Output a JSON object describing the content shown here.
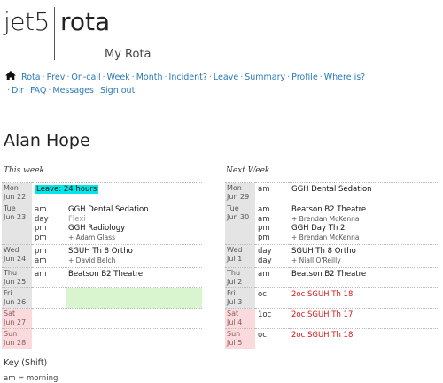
{
  "logo": {
    "left": "jet5",
    "right": "rota"
  },
  "subtitle": "My Rota",
  "nav": {
    "items": [
      {
        "label": "Rota",
        "active": true
      },
      {
        "label": "Prev"
      },
      {
        "label": "On-call"
      },
      {
        "label": "Week"
      },
      {
        "label": "Month"
      },
      {
        "label": "Incident?"
      },
      {
        "label": "Leave"
      },
      {
        "label": "Summary"
      },
      {
        "label": "Profile"
      },
      {
        "label": "Where is?"
      },
      {
        "label": "Dir"
      },
      {
        "label": "FAQ"
      },
      {
        "label": "Messages"
      },
      {
        "label": "Sign out"
      }
    ]
  },
  "person": "Alan Hope",
  "this_week": {
    "title": "This week",
    "rows": [
      {
        "day": "Mon",
        "date": "Jun 22",
        "periods": [],
        "details": [
          {
            "text": "Leave: 24 hours",
            "style": "leave"
          }
        ]
      },
      {
        "day": "Tue",
        "date": "Jun 23",
        "periods": [
          "am",
          "day",
          "pm",
          "pm"
        ],
        "details": [
          {
            "text": "GGH Dental Sedation"
          },
          {
            "text": "Flexi",
            "style": "grey"
          },
          {
            "text": "GGH Radiology"
          },
          {
            "text": "+ Adam Glass",
            "style": "sub"
          }
        ]
      },
      {
        "day": "Wed",
        "date": "Jun 24",
        "periods": [
          "pm",
          "am"
        ],
        "details": [
          {
            "text": "SGUH Th 8 Ortho"
          },
          {
            "text": "+ David Belch",
            "style": "sub"
          }
        ]
      },
      {
        "day": "Thu",
        "date": "Jun 25",
        "periods": [
          "am"
        ],
        "details": [
          {
            "text": "Beatson B2 Theatre"
          }
        ]
      },
      {
        "day": "Fri",
        "date": "Jun 26",
        "periods": [],
        "details": [],
        "green": true
      },
      {
        "day": "Sat",
        "date": "Jun 27",
        "periods": [],
        "details": [],
        "weekend": true
      },
      {
        "day": "Sun",
        "date": "Jun 28",
        "periods": [],
        "details": [],
        "weekend": true
      }
    ]
  },
  "next_week": {
    "title": "Next Week",
    "rows": [
      {
        "day": "Mon",
        "date": "Jun 29",
        "periods": [
          "am"
        ],
        "details": [
          {
            "text": "GGH Dental Sedation"
          }
        ]
      },
      {
        "day": "Tue",
        "date": "Jun 30",
        "periods": [
          "am",
          "am",
          "pm",
          "pm"
        ],
        "details": [
          {
            "text": "Beatson B2 Theatre"
          },
          {
            "text": "+ Brendan McKenna",
            "style": "sub"
          },
          {
            "text": "GGH Day Th 2"
          },
          {
            "text": "+ Brendan McKenna",
            "style": "sub"
          }
        ]
      },
      {
        "day": "Wed",
        "date": "Jul 1",
        "periods": [
          "day",
          "day"
        ],
        "details": [
          {
            "text": "SGUH Th 8 Ortho"
          },
          {
            "text": "+ Niall O'Reilly",
            "style": "sub"
          }
        ]
      },
      {
        "day": "Thu",
        "date": "Jul 2",
        "periods": [
          "am"
        ],
        "details": [
          {
            "text": "Beatson B2 Theatre"
          }
        ]
      },
      {
        "day": "Fri",
        "date": "Jul 3",
        "periods": [
          "oc"
        ],
        "details": [
          {
            "text": "2oc SGUH Th 18",
            "style": "red"
          }
        ]
      },
      {
        "day": "Sat",
        "date": "Jul 4",
        "periods": [
          "1oc"
        ],
        "details": [
          {
            "text": "2oc SGUH Th 17",
            "style": "red"
          }
        ],
        "weekend": true
      },
      {
        "day": "Sun",
        "date": "Jul 5",
        "periods": [
          "oc"
        ],
        "details": [
          {
            "text": "2oc SGUH Th 18",
            "style": "red"
          }
        ],
        "weekend": true
      }
    ]
  },
  "key": {
    "title": "Key (Shift)",
    "first": "am = morning"
  },
  "colors": {
    "link": "#2a7ab8",
    "leave": "#00e5e5",
    "weekend": "#fadadd",
    "oncall": "#d01818"
  }
}
